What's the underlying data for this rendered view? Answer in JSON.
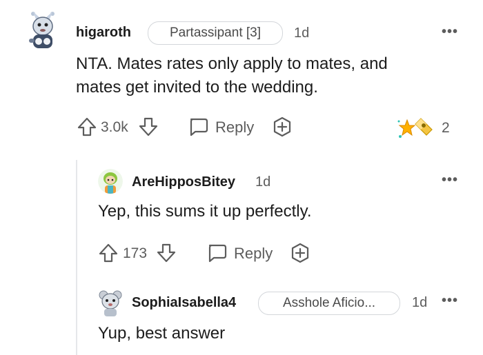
{
  "comments": [
    {
      "username": "higaroth",
      "flair": "Partassipant [3]",
      "time": "1d",
      "body_line1": "NTA. Mates rates only apply to mates, and",
      "body_line2": "mates get invited to the wedding.",
      "votes": "3.0k",
      "reply_label": "Reply",
      "award_count": "2"
    },
    {
      "username": "AreHipposBitey",
      "time": "1d",
      "body": "Yep, this sums it up perfectly.",
      "votes": "173",
      "reply_label": "Reply"
    },
    {
      "username": "SophiaIsabella4",
      "flair": "Asshole Aficio...",
      "time": "1d",
      "body": "Yup, best answer"
    }
  ],
  "more_options": "•••",
  "icons": [
    "upvote-icon",
    "downvote-icon",
    "reply-bubble-icon",
    "add-award-icon",
    "award-icon",
    "more-options-icon"
  ],
  "colors": {
    "text": "#1c1c1c",
    "muted": "#5c5c5c",
    "flair_border": "#d3d6da",
    "thread_line": "#e5e7ea"
  }
}
